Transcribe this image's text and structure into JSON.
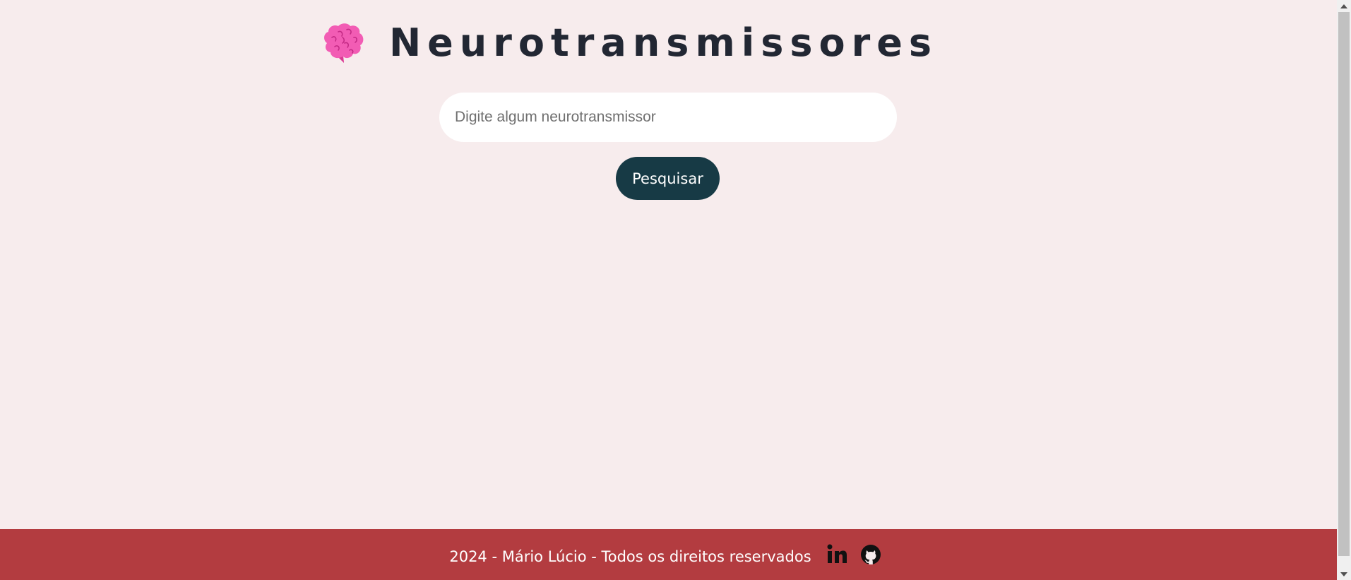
{
  "header": {
    "title": "Neurotransmissores",
    "icon": "brain-icon"
  },
  "search": {
    "placeholder": "Digite algum neurotransmissor",
    "value": "",
    "button_label": "Pesquisar"
  },
  "footer": {
    "text": "2024 - Mário Lúcio - Todos os direitos reservados",
    "social": [
      "linkedin-icon",
      "github-icon"
    ]
  },
  "colors": {
    "background": "#f7eced",
    "title": "#222733",
    "button": "#173a45",
    "footer": "#b33c40",
    "brain": "#f25cb4"
  }
}
